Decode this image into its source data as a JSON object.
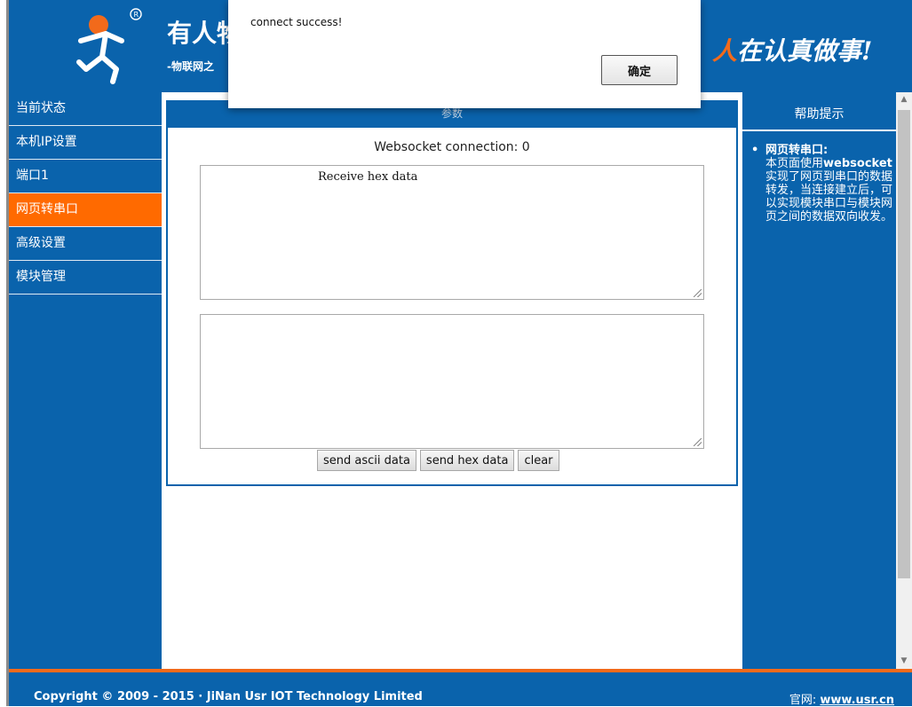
{
  "header": {
    "company_title": "有人物",
    "company_sub": "-物联网之",
    "slogan_highlight": "人",
    "slogan_rest": "在认真做事!",
    "logo_icon": "walking-person-logo-icon"
  },
  "sidebar": {
    "items": [
      {
        "label": "当前状态",
        "active": false
      },
      {
        "label": "本机IP设置",
        "active": false
      },
      {
        "label": "端口1",
        "active": false
      },
      {
        "label": "网页转串口",
        "active": true
      },
      {
        "label": "高级设置",
        "active": false
      },
      {
        "label": "模块管理",
        "active": false
      }
    ]
  },
  "main": {
    "panel_title": "参数",
    "ws_status": "Websocket connection: 0",
    "receive_text": "Receive hex data",
    "send_text": "",
    "buttons": {
      "send_ascii": "send ascii data",
      "send_hex": "send hex data",
      "clear": "clear"
    }
  },
  "help": {
    "title": "帮助提示",
    "bullet": "•",
    "item_title": "网页转串口:",
    "item_body_keyword": "websocket",
    "item_body_pre": "本页面使用",
    "item_body_post": "实现了网页到串口的数据转发，当连接建立后，可以实现模块串口与模块网页之间的数据双向收发。"
  },
  "footer": {
    "copyright": "Copyright © 2009 - 2015 · JiNan Usr IOT Technology Limited",
    "site_label": "官网:",
    "site_link": "www.usr.cn"
  },
  "dialog": {
    "message": "connect success!",
    "ok_label": "确定"
  },
  "colors": {
    "brand_blue": "#0a63ac",
    "accent_orange": "#ff6a00"
  }
}
